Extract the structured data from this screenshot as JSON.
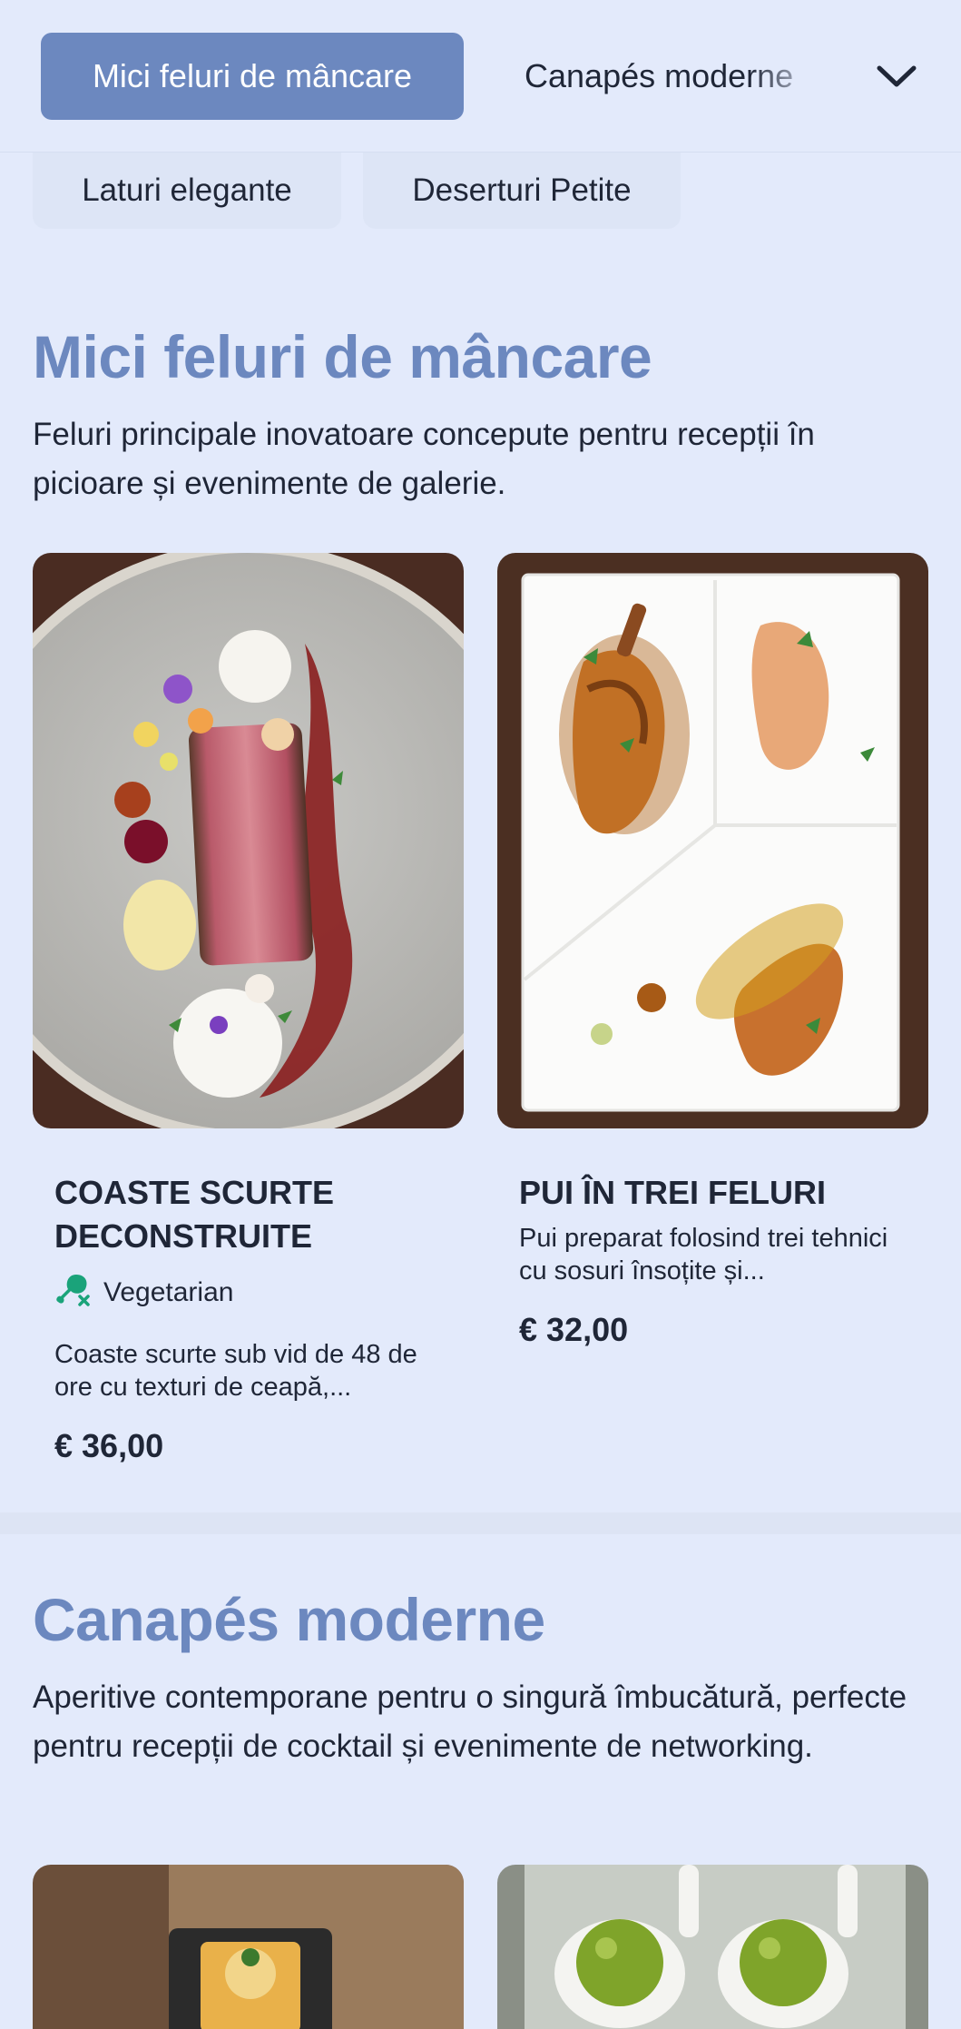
{
  "nav": {
    "active_tab": "Mici feluri de mâncare",
    "next_tab": "Canapés moderne",
    "chips": [
      "Laturi elegante",
      "Deserturi Petite"
    ]
  },
  "sections": [
    {
      "title": "Mici feluri de mâncare",
      "description": "Feluri principale inovatoare concepute pentru recepții în picioare și evenimente de galerie.",
      "items": [
        {
          "name": "COASTE SCURTE DECONSTRUITE",
          "diet": "Vegetarian",
          "description": "Coaste scurte sub vid de 48 de ore cu texturi de ceapă,...",
          "price": "€ 36,00"
        },
        {
          "name": "PUI ÎN TREI FELURI",
          "description": "Pui preparat folosind trei tehnici cu sosuri însoțite și...",
          "price": "€ 32,00"
        }
      ]
    },
    {
      "title": "Canapés moderne",
      "description": "Aperitive contemporane pentru o singură îmbucătură, perfecte pentru recepții de cocktail și evenimente de networking."
    }
  ],
  "colors": {
    "background": "#e3eafb",
    "accent": "#6c88bf",
    "diet_icon": "#1aa37a"
  },
  "icons": {
    "dropdown": "chevron-down-icon",
    "diet": "drumstick-crossed-icon"
  }
}
